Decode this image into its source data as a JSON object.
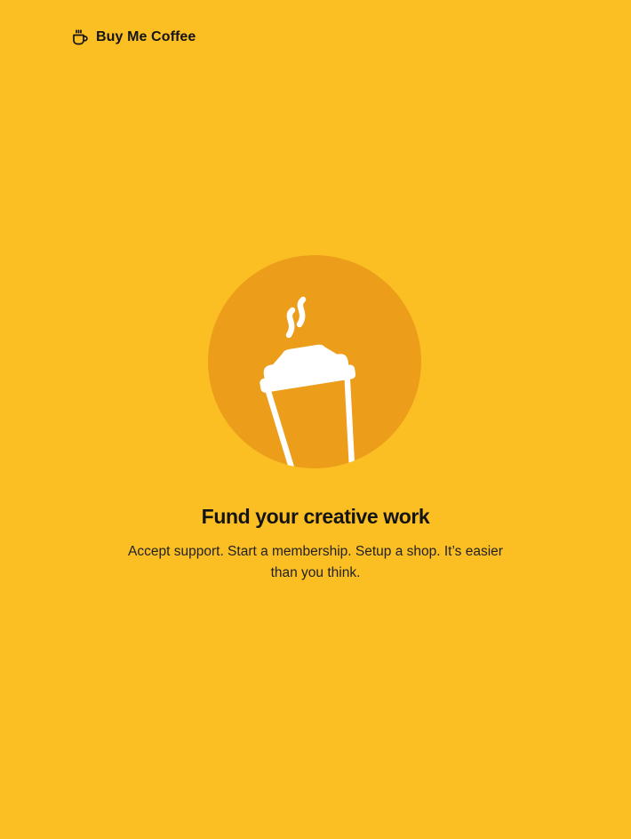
{
  "brand": {
    "name": "Buy Me Coffee",
    "icon": "coffee-cup-icon"
  },
  "hero": {
    "illustration_icon": "takeaway-coffee-cup-icon",
    "title": "Fund your creative work",
    "subtitle": "Accept support. Start a membership. Setup a shop. It’s easier than you think."
  },
  "colors": {
    "background": "#FBBF24",
    "circle": "#EC9D19",
    "text": "#141414",
    "illustration": "#FFFFFF"
  }
}
